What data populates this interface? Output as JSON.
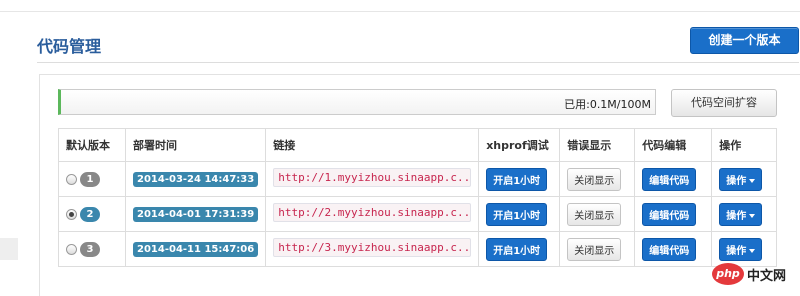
{
  "header": {
    "title": "代码管理",
    "create_button": "创建一个版本"
  },
  "quota": {
    "used_label": "已用:0.1M/100M",
    "expand_button": "代码空间扩容"
  },
  "table": {
    "columns": [
      "默认版本",
      "部署时间",
      "链接",
      "xhprof调试",
      "错误显示",
      "代码编辑",
      "操作"
    ],
    "rows": [
      {
        "version": "1",
        "selected": false,
        "time": "2014-03-24 14:47:33",
        "link": "http://1.myyizhou.sinaapp.c...",
        "xhprof": "开启1小时",
        "error": "关闭显示",
        "edit": "编辑代码",
        "action": "操作"
      },
      {
        "version": "2",
        "selected": true,
        "time": "2014-04-01 17:31:39",
        "link": "http://2.myyizhou.sinaapp.c...",
        "xhprof": "开启1小时",
        "error": "关闭显示",
        "edit": "编辑代码",
        "action": "操作"
      },
      {
        "version": "3",
        "selected": false,
        "time": "2014-04-11 15:47:06",
        "link": "http://3.myyizhou.sinaapp.c...",
        "xhprof": "开启1小时",
        "error": "关闭显示",
        "edit": "编辑代码",
        "action": "操作"
      }
    ]
  },
  "watermark": {
    "logo": "php",
    "text": "中文网"
  },
  "colors": {
    "primary_button": "#1a6fc9",
    "title": "#2a5d9c",
    "label": "#3a87ad",
    "quota_bar": "#5cb85c"
  }
}
